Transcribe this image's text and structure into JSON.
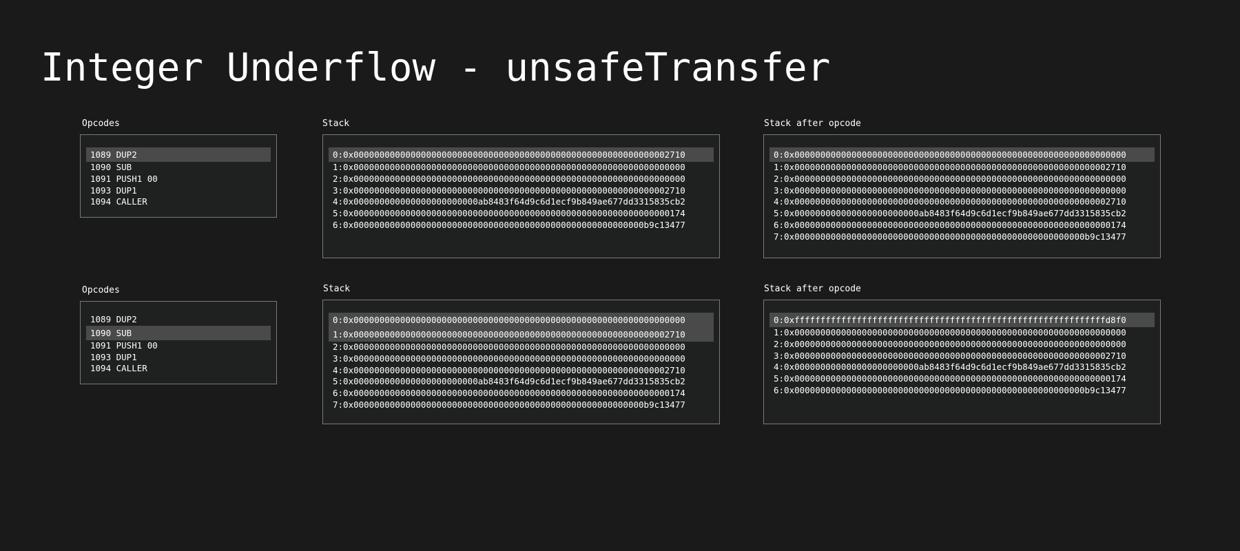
{
  "title": "Integer Underflow - unsafeTransfer",
  "labels": {
    "opcodes": "Opcodes",
    "stack": "Stack",
    "stack_after": "Stack after opcode"
  },
  "opcodes": [
    "1089 DUP2",
    "1090 SUB",
    "1091 PUSH1 00",
    "1093 DUP1",
    "1094 CALLER"
  ],
  "steps": [
    {
      "selected_opcode": 0,
      "stack": [
        "0:0x0000000000000000000000000000000000000000000000000000000000002710",
        "1:0x0000000000000000000000000000000000000000000000000000000000000000",
        "2:0x0000000000000000000000000000000000000000000000000000000000000000",
        "3:0x0000000000000000000000000000000000000000000000000000000000002710",
        "4:0x000000000000000000000000ab8483f64d9c6d1ecf9b849ae677dd3315835cb2",
        "5:0x0000000000000000000000000000000000000000000000000000000000000174",
        "6:0x00000000000000000000000000000000000000000000000000000000b9c13477"
      ],
      "stack_selected": 0,
      "stack_after": [
        "0:0x0000000000000000000000000000000000000000000000000000000000000000",
        "1:0x0000000000000000000000000000000000000000000000000000000000002710",
        "2:0x0000000000000000000000000000000000000000000000000000000000000000",
        "3:0x0000000000000000000000000000000000000000000000000000000000000000",
        "4:0x0000000000000000000000000000000000000000000000000000000000002710",
        "5:0x000000000000000000000000ab8483f64d9c6d1ecf9b849ae677dd3315835cb2",
        "6:0x0000000000000000000000000000000000000000000000000000000000000174",
        "7:0x00000000000000000000000000000000000000000000000000000000b9c13477"
      ],
      "stack_after_selected": 0
    },
    {
      "selected_opcode": 1,
      "stack": [
        "0:0x0000000000000000000000000000000000000000000000000000000000000000",
        "1:0x0000000000000000000000000000000000000000000000000000000000002710",
        "2:0x0000000000000000000000000000000000000000000000000000000000000000",
        "3:0x0000000000000000000000000000000000000000000000000000000000000000",
        "4:0x0000000000000000000000000000000000000000000000000000000000002710",
        "5:0x000000000000000000000000ab8483f64d9c6d1ecf9b849ae677dd3315835cb2",
        "6:0x0000000000000000000000000000000000000000000000000000000000000174",
        "7:0x00000000000000000000000000000000000000000000000000000000b9c13477"
      ],
      "stack_selected": [
        0,
        1
      ],
      "stack_after": [
        "0:0xffffffffffffffffffffffffffffffffffffffffffffffffffffffffffffd8f0",
        "1:0x0000000000000000000000000000000000000000000000000000000000000000",
        "2:0x0000000000000000000000000000000000000000000000000000000000000000",
        "3:0x0000000000000000000000000000000000000000000000000000000000002710",
        "4:0x000000000000000000000000ab8483f64d9c6d1ecf9b849ae677dd3315835cb2",
        "5:0x0000000000000000000000000000000000000000000000000000000000000174",
        "6:0x00000000000000000000000000000000000000000000000000000000b9c13477"
      ],
      "stack_after_selected": 0
    }
  ]
}
